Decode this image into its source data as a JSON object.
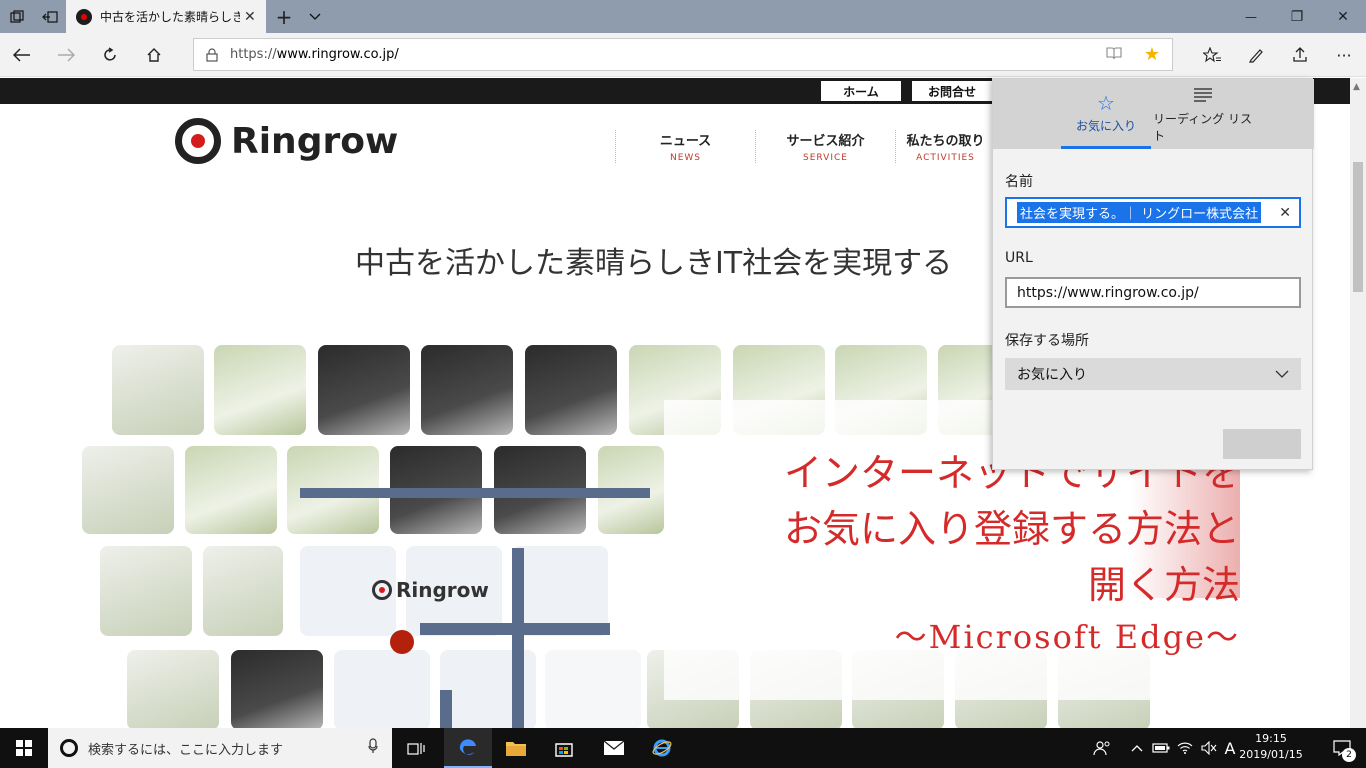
{
  "browser": {
    "tab_title": "中古を活かした素晴らしき",
    "new_tab": "+",
    "tab_close": "✕",
    "url_prefix": "https://",
    "url_host": "www.ringrow.co.jp/",
    "window_minimize": "—",
    "window_restore": "❐",
    "window_close": "✕"
  },
  "site": {
    "top_links": [
      "ホーム",
      "お問合せ"
    ],
    "logo_text": "Ringrow",
    "nav": [
      {
        "jp": "ニュース",
        "en": "NEWS"
      },
      {
        "jp": "サービス紹介",
        "en": "SERVICE"
      },
      {
        "jp": "私たちの取り",
        "en": "ACTIVITIES"
      }
    ],
    "headline": "中古を活かした素晴らしきIT社会を実現する",
    "bag_logo_text": "Ringrow"
  },
  "overlay": {
    "line1": "インターネットでサイトを",
    "line2": "お気に入り登録する方法と",
    "line3": "開く方法",
    "line4": "～Microsoft Edge～"
  },
  "favorites_panel": {
    "tab_favorites": "お気に入り",
    "tab_reading_list": "リーディング リスト",
    "name_label": "名前",
    "name_value": "社会を実現する。｜ リングロー株式会社",
    "url_label": "URL",
    "url_value": "https://www.ringrow.co.jp/",
    "location_label": "保存する場所",
    "location_value": "お気に入り"
  },
  "taskbar": {
    "search_placeholder": "検索するには、ここに入力します",
    "time": "19:15",
    "date": "2019/01/15",
    "ime": "A",
    "notification_count": "2"
  }
}
